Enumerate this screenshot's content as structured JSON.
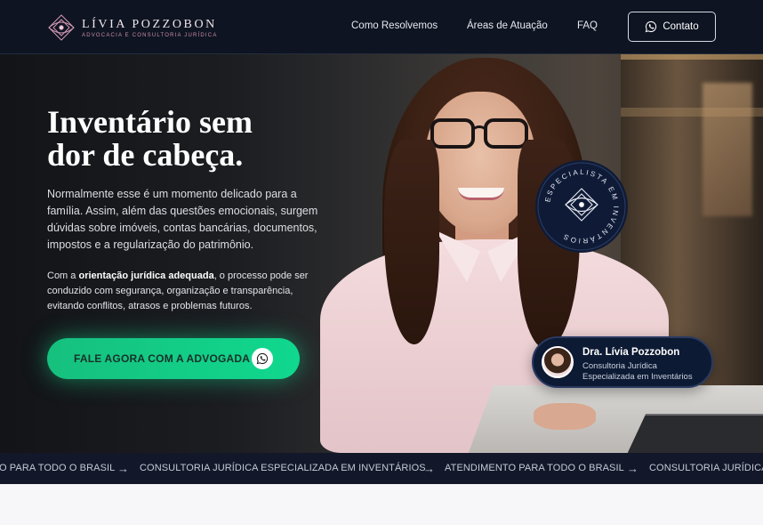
{
  "header": {
    "logo_name": "LÍVIA POZZOBON",
    "logo_tagline": "ADVOCACIA E CONSULTORIA JURÍDICA",
    "nav": [
      "Como Resolvemos",
      "Áreas de Atuação",
      "FAQ"
    ],
    "contact_label": "Contato"
  },
  "hero": {
    "title_line1": "Inventário sem",
    "title_line2": "dor de cabeça.",
    "paragraph1": "Normalmente esse é um momento delicado para a família. Assim, além das questões emocionais, surgem dúvidas sobre imóveis, contas bancárias, documentos, impostos e a regularização do patrimônio.",
    "paragraph2_prefix": "Com a ",
    "paragraph2_bold": "orientação jurídica adequada",
    "paragraph2_suffix": ", o processo pode ser conduzido com segurança, organização e transparência, evitando conflitos, atrasos e problemas futuros.",
    "cta_label": "FALE AGORA COM A ADVOGADA",
    "badge_text": "ESPECIALISTA EM INVENTÁRIOS"
  },
  "profile_card": {
    "name": "Dra. Lívia Pozzobon",
    "subtitle_line1": "Consultoria Jurídica",
    "subtitle_line2": "Especializada em Inventários"
  },
  "marquee": {
    "items": [
      "O PARA TODO O BRASIL",
      "CONSULTORIA JURÍDICA ESPECIALIZADA EM INVENTÁRIOS",
      "ATENDIMENTO PARA TODO O BRASIL",
      "CONSULTORIA JURÍDICA"
    ],
    "separator": "→"
  },
  "colors": {
    "header_bg": "#0e1422",
    "cta_green": "#16c07e",
    "card_bg": "#0d1a33",
    "logo_accent": "#c98ea6"
  },
  "icons": [
    "logo-ornament-icon",
    "whatsapp-icon",
    "arrow-right-icon"
  ]
}
